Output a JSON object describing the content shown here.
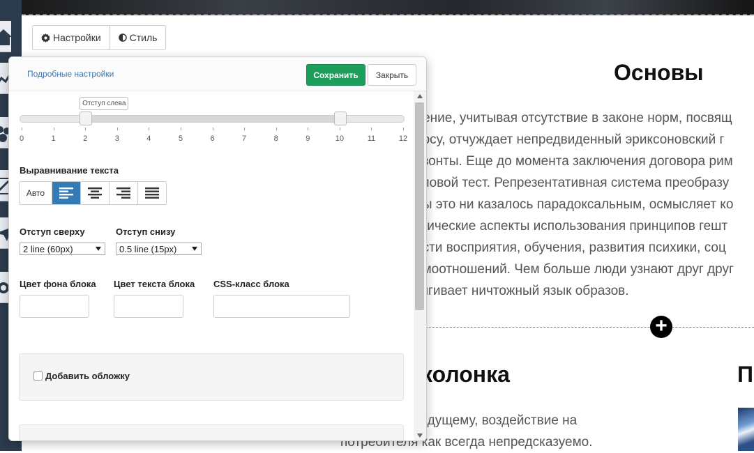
{
  "tabs": {
    "settings_label": "Настройки",
    "style_label": "Стиль"
  },
  "panel": {
    "advanced_link": "Подробные настройки",
    "save_label": "Сохранить",
    "close_label": "Закрыть"
  },
  "slider": {
    "tooltip": "Отступ слева",
    "ticks": [
      "0",
      "1",
      "2",
      "3",
      "4",
      "5",
      "6",
      "7",
      "8",
      "9",
      "10",
      "11",
      "12"
    ],
    "min": 0,
    "max": 12,
    "left_value": 2,
    "right_value": 10
  },
  "alignment": {
    "label": "Выравнивание текста",
    "auto_label": "Авто",
    "selected": "left"
  },
  "padding": {
    "top_label": "Отступ сверху",
    "top_value": "2 line (60px)",
    "bottom_label": "Отступ снизу",
    "bottom_value": "0.5 line (15px)"
  },
  "block": {
    "bg_color_label": "Цвет фона блока",
    "text_color_label": "Цвет текста блока",
    "css_class_label": "CSS-класс блока",
    "cover_label": "Добавить обложку"
  },
  "article": {
    "title": "Основы",
    "lines": [
      "дение, учитывая отсутствие в законе норм, посвящ",
      "росу, отчуждает непредвиденный эриксоновский г",
      "изонты. Еще до момента заключения договора рим",
      "пповой тест. Репрезентативная система преобразу",
      "бы это ни казалось парадоксальным, осмысляет ко",
      "ктические аспекты использования принципов гешт",
      "асти восприятия, обучения, развития психики, соц",
      "имоотношений. Чем больше люди узнают друг друг",
      "тягивает ничтожный язык образов."
    ],
    "add_symbol": "+",
    "column_title": "колонка",
    "column_title_2": "П",
    "column_lines": [
      "                 едыдущему, воздействие на",
      "потребителя как всегда непредсказуемо."
    ]
  },
  "colors": {
    "save_button": "#1e9e5b",
    "active_align": "#337ab7",
    "link": "#3a76b0"
  }
}
